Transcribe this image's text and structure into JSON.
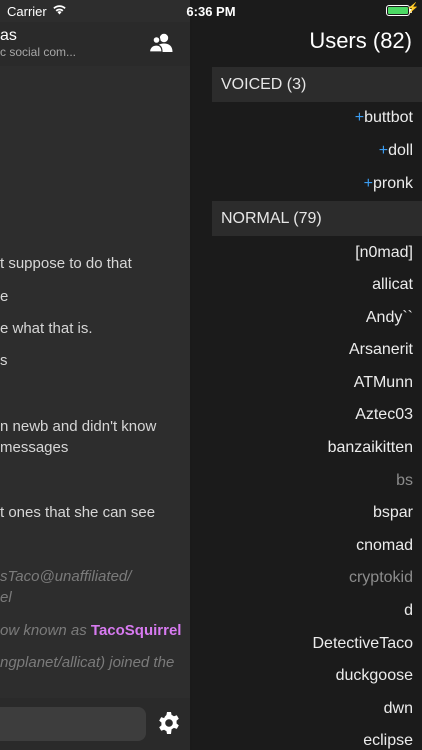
{
  "status_bar": {
    "carrier": "Carrier",
    "time": "6:36 PM",
    "battery_color": "#4cd964"
  },
  "chat": {
    "channel_name": "as",
    "channel_topic": "c social com...",
    "users_icon": "users-icon",
    "messages": [
      {
        "text": "t suppose to do that",
        "type": "normal"
      },
      {
        "text": "e",
        "type": "normal"
      },
      {
        "text": "e what that is.",
        "type": "normal"
      },
      {
        "text": "s",
        "type": "normal"
      },
      {
        "text": "n newb and didn't know",
        "type": "normal"
      },
      {
        "text": "messages",
        "type": "normal"
      },
      {
        "text": "t ones that she can see",
        "type": "normal"
      },
      {
        "text": "sTaco@unaffiliated/",
        "type": "system"
      },
      {
        "text": "el",
        "type": "system"
      },
      {
        "text": "ow known as ",
        "type": "system"
      },
      {
        "text": "ngplanet/allicat) joined the",
        "type": "system"
      }
    ],
    "renamed_nick": "TacoSquirrel",
    "nick_highlight_color": "#d77af0",
    "input_placeholder": "",
    "settings_icon": "gear-icon"
  },
  "users": {
    "title": "Users (82)",
    "voiced_header": "VOICED (3)",
    "voiced": [
      {
        "prefix": "+",
        "name": "buttbot",
        "away": false
      },
      {
        "prefix": "+",
        "name": "doll",
        "away": false
      },
      {
        "prefix": "+",
        "name": "pronk",
        "away": false
      }
    ],
    "normal_header": "NORMAL (79)",
    "normal": [
      {
        "name": "[n0mad]",
        "away": false
      },
      {
        "name": "allicat",
        "away": false
      },
      {
        "name": "Andy``",
        "away": false
      },
      {
        "name": "Arsanerit",
        "away": false
      },
      {
        "name": "ATMunn",
        "away": false
      },
      {
        "name": "Aztec03",
        "away": false
      },
      {
        "name": "banzaikitten",
        "away": false
      },
      {
        "name": "bs",
        "away": true
      },
      {
        "name": "bspar",
        "away": false
      },
      {
        "name": "cnomad",
        "away": false
      },
      {
        "name": "cryptokid",
        "away": true
      },
      {
        "name": "d",
        "away": false
      },
      {
        "name": "DetectiveTaco",
        "away": false
      },
      {
        "name": "duckgoose",
        "away": false
      },
      {
        "name": "dwn",
        "away": false
      },
      {
        "name": "eclipse",
        "away": false
      }
    ],
    "prefix_color": "#3b9cf0"
  }
}
